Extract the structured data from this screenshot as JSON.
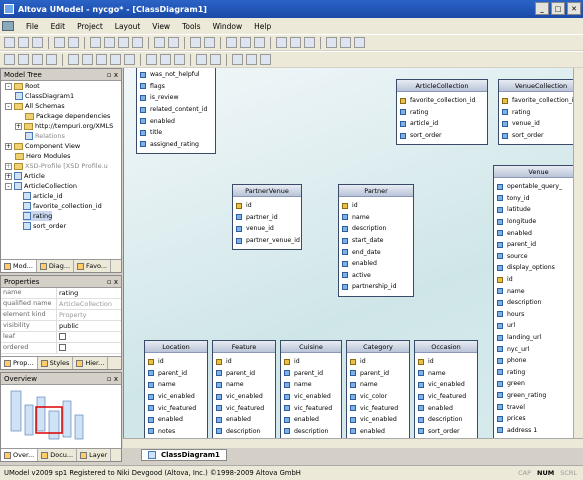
{
  "window": {
    "title": "Altova UModel - nycgo* - [ClassDiagram1]"
  },
  "menu": [
    "File",
    "Edit",
    "Project",
    "Layout",
    "View",
    "Tools",
    "Window",
    "Help"
  ],
  "model_tree": {
    "title": "Model Tree",
    "items": [
      {
        "label": "Root",
        "icon": "folder-icon"
      },
      {
        "label": "ClassDiagram1",
        "icon": "diagram-icon"
      },
      {
        "label": "All Schemas",
        "icon": "folder-icon"
      },
      {
        "label": "Package dependencies",
        "icon": "package-icon"
      },
      {
        "label": "http://tempuri.org/XMLS",
        "icon": "namespace-icon"
      },
      {
        "label": "Relations",
        "icon": "relation-icon"
      },
      {
        "label": "Component View",
        "icon": "folder-icon"
      },
      {
        "label": "Hero Modules",
        "icon": "folder-icon"
      },
      {
        "label": "XSD-Profile [XSD Profile.u",
        "icon": "profile-icon"
      },
      {
        "label": "Article",
        "icon": "class-icon"
      },
      {
        "label": "ArticleCollection",
        "icon": "class-icon"
      },
      {
        "label": "article_id",
        "icon": "attribute-icon"
      },
      {
        "label": "favorite_collection_id",
        "icon": "attribute-icon"
      },
      {
        "label": "rating",
        "icon": "attribute-icon"
      },
      {
        "label": "sort_order",
        "icon": "attribute-icon"
      }
    ],
    "tabs": [
      "Mod...",
      "Diag...",
      "Favo..."
    ]
  },
  "properties": {
    "title": "Properties",
    "rows": [
      {
        "key": "name",
        "value": "rating"
      },
      {
        "key": "qualified name",
        "value": "ArticleCollection"
      },
      {
        "key": "element kind",
        "value": "Property"
      },
      {
        "key": "visibility",
        "value": "public"
      },
      {
        "key": "leaf",
        "value": ""
      },
      {
        "key": "ordered",
        "value": ""
      }
    ],
    "tabs": [
      "Prop...",
      "Styles",
      "Hier..."
    ]
  },
  "overview": {
    "title": "Overview",
    "tabs": [
      "Over...",
      "Docu...",
      "Layer"
    ]
  },
  "classes": [
    {
      "name": "",
      "attrs": [
        [
          "was_not_helpful",
          0
        ],
        [
          "flags",
          0
        ],
        [
          "is_review",
          0
        ],
        [
          "related_content_id",
          0
        ],
        [
          "enabled",
          0
        ],
        [
          "title",
          0
        ],
        [
          "assigned_rating",
          0
        ]
      ]
    },
    {
      "name": "ArticleCollection",
      "attrs": [
        [
          "favorite_collection_id",
          1
        ],
        [
          "rating",
          0
        ],
        [
          "article_id",
          0
        ],
        [
          "sort_order",
          0
        ]
      ]
    },
    {
      "name": "VenueCollection",
      "attrs": [
        [
          "favorite_collection_id",
          1
        ],
        [
          "rating",
          0
        ],
        [
          "venue_id",
          0
        ],
        [
          "sort_order",
          0
        ]
      ]
    },
    {
      "name": "PartnerVenue",
      "attrs": [
        [
          "id",
          1
        ],
        [
          "partner_id",
          0
        ],
        [
          "venue_id",
          0
        ],
        [
          "partner_venue_id",
          0
        ]
      ]
    },
    {
      "name": "Partner",
      "attrs": [
        [
          "id",
          1
        ],
        [
          "name",
          0
        ],
        [
          "description",
          0
        ],
        [
          "start_date",
          0
        ],
        [
          "end_date",
          0
        ],
        [
          "enabled",
          0
        ],
        [
          "active",
          0
        ],
        [
          "partnership_id",
          0
        ]
      ]
    },
    {
      "name": "Venue",
      "attrs": [
        [
          "opentable_query_",
          0
        ],
        [
          "tony_id",
          0
        ],
        [
          "latitude",
          0
        ],
        [
          "longitude",
          0
        ],
        [
          "enabled",
          0
        ],
        [
          "parent_id",
          0
        ],
        [
          "source",
          0
        ],
        [
          "display_options",
          0
        ],
        [
          "id",
          1
        ],
        [
          "name",
          0
        ],
        [
          "description",
          0
        ],
        [
          "hours",
          0
        ],
        [
          "url",
          0
        ],
        [
          "landing_url",
          0
        ],
        [
          "nyc_url",
          0
        ],
        [
          "phone",
          0
        ],
        [
          "rating",
          0
        ],
        [
          "green",
          0
        ],
        [
          "green_rating",
          0
        ],
        [
          "travel",
          0
        ],
        [
          "prices",
          0
        ],
        [
          "address 1",
          0
        ]
      ]
    },
    {
      "name": "Location",
      "attrs": [
        [
          "id",
          1
        ],
        [
          "parent_id",
          0
        ],
        [
          "name",
          0
        ],
        [
          "vic_enabled",
          0
        ],
        [
          "vic_featured",
          0
        ],
        [
          "enabled",
          0
        ],
        [
          "notes",
          0
        ]
      ]
    },
    {
      "name": "Feature",
      "attrs": [
        [
          "id",
          1
        ],
        [
          "parent_id",
          0
        ],
        [
          "name",
          0
        ],
        [
          "vic_enabled",
          0
        ],
        [
          "vic_featured",
          0
        ],
        [
          "enabled",
          0
        ],
        [
          "description",
          0
        ]
      ]
    },
    {
      "name": "Cuisine",
      "attrs": [
        [
          "id",
          1
        ],
        [
          "parent_id",
          0
        ],
        [
          "name",
          0
        ],
        [
          "vic_enabled",
          0
        ],
        [
          "vic_featured",
          0
        ],
        [
          "enabled",
          0
        ],
        [
          "description",
          0
        ]
      ]
    },
    {
      "name": "Category",
      "attrs": [
        [
          "id",
          1
        ],
        [
          "parent_id",
          0
        ],
        [
          "name",
          0
        ],
        [
          "vic_color",
          0
        ],
        [
          "vic_featured",
          0
        ],
        [
          "vic_enabled",
          0
        ],
        [
          "enabled",
          0
        ]
      ]
    },
    {
      "name": "Occasion",
      "attrs": [
        [
          "id",
          1
        ],
        [
          "name",
          0
        ],
        [
          "vic_enabled",
          0
        ],
        [
          "vic_featured",
          0
        ],
        [
          "enabled",
          0
        ],
        [
          "description",
          0
        ],
        [
          "sort_order",
          0
        ]
      ]
    }
  ],
  "doc_tab": "ClassDiagram1",
  "status": {
    "text": "UModel v2009 sp1   Registered to Niki Devgood (Altova, Inc.)   ©1998-2009 Altova GmbH",
    "indicators": [
      "CAP",
      "NUM",
      "SCRL"
    ]
  }
}
